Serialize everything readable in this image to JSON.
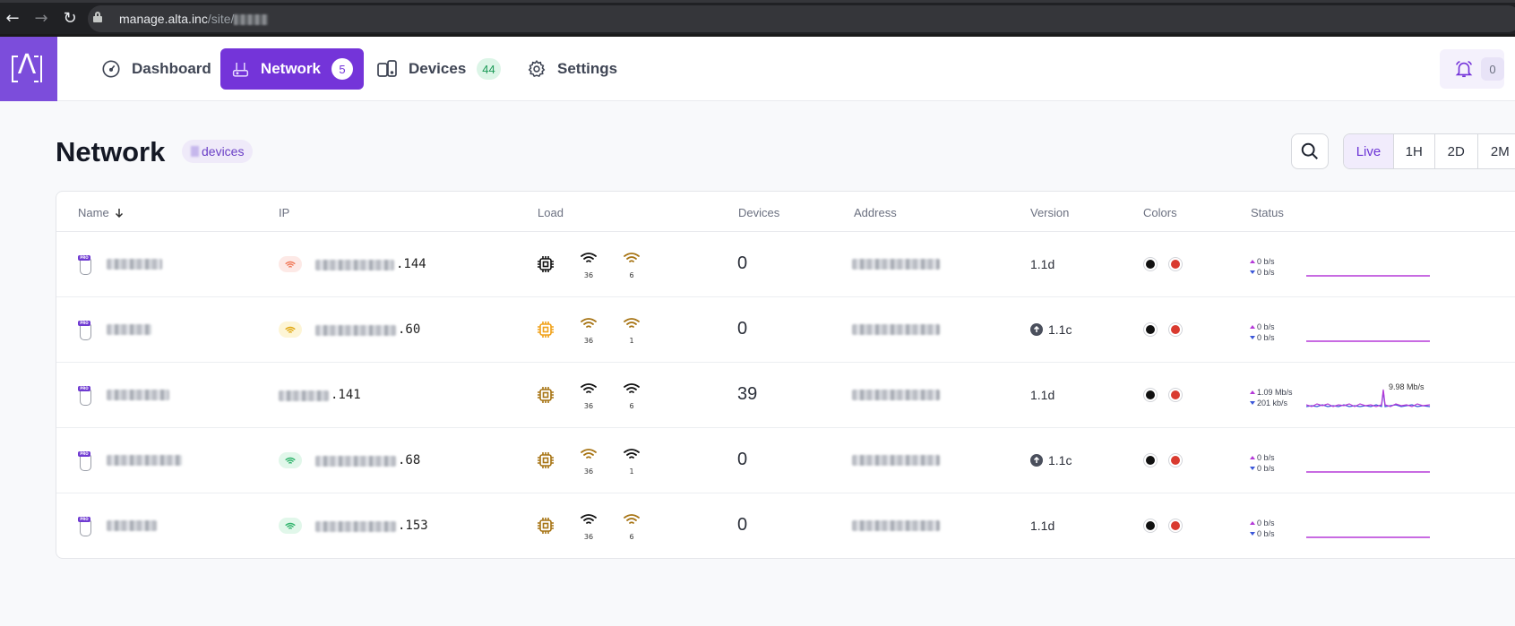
{
  "browser": {
    "url_domain": "manage.alta.inc",
    "url_path": "/site/"
  },
  "nav": {
    "tabs": [
      {
        "label": "Dashboard",
        "icon": "gauge-icon"
      },
      {
        "label": "Network",
        "icon": "router-icon",
        "badge": "5",
        "active": true
      },
      {
        "label": "Devices",
        "icon": "devices-icon",
        "badge": "44"
      },
      {
        "label": "Settings",
        "icon": "gear-icon"
      }
    ],
    "notifications_count": "0"
  },
  "page": {
    "title": "Network",
    "chip_label": "devices"
  },
  "time_ranges": [
    "Live",
    "1H",
    "2D",
    "2M"
  ],
  "table": {
    "headers": {
      "name": "Name",
      "ip": "IP",
      "load": "Load",
      "devices": "Devices",
      "address": "Address",
      "version": "Version",
      "colors": "Colors",
      "status": "Status"
    },
    "rows": [
      {
        "ip_suffix": ".144",
        "wifi_pill_color": "#fde9e6",
        "wifi_icon_color": "#f07a5a",
        "cpu_color": "#111111",
        "wifi1": "36",
        "wifi1_color": "#111111",
        "wifi2": "6",
        "wifi2_color": "#a77414",
        "devices": "0",
        "version": "1.1d",
        "update_available": false,
        "status_up": "0 b/s",
        "status_down": "0 b/s",
        "peak": ""
      },
      {
        "ip_suffix": ".60",
        "wifi_pill_color": "#fdf5d6",
        "wifi_icon_color": "#e0a710",
        "cpu_color": "#f0a21a",
        "wifi1": "36",
        "wifi1_color": "#a77414",
        "wifi2": "1",
        "wifi2_color": "#a77414",
        "devices": "0",
        "version": "1.1c",
        "update_available": true,
        "status_up": "0 b/s",
        "status_down": "0 b/s",
        "peak": ""
      },
      {
        "ip_suffix": ".141",
        "wifi_pill_color": "",
        "wifi_icon_color": "",
        "cpu_color": "#a77414",
        "wifi1": "36",
        "wifi1_color": "#111111",
        "wifi2": "6",
        "wifi2_color": "#111111",
        "devices": "39",
        "version": "1.1d",
        "update_available": false,
        "status_up": "1.09 Mb/s",
        "status_down": "201 kb/s",
        "peak": "9.98 Mb/s"
      },
      {
        "ip_suffix": ".68",
        "wifi_pill_color": "#e1f7ea",
        "wifi_icon_color": "#2fb36b",
        "cpu_color": "#a77414",
        "wifi1": "36",
        "wifi1_color": "#a77414",
        "wifi2": "1",
        "wifi2_color": "#111111",
        "devices": "0",
        "version": "1.1c",
        "update_available": true,
        "status_up": "0 b/s",
        "status_down": "0 b/s",
        "peak": ""
      },
      {
        "ip_suffix": ".153",
        "wifi_pill_color": "#e1f7ea",
        "wifi_icon_color": "#2fb36b",
        "cpu_color": "#a77414",
        "wifi1": "36",
        "wifi1_color": "#111111",
        "wifi2": "6",
        "wifi2_color": "#a77414",
        "devices": "0",
        "version": "1.1d",
        "update_available": false,
        "status_up": "0 b/s",
        "status_down": "0 b/s",
        "peak": ""
      }
    ]
  },
  "colors": {
    "accent": "#7434d9",
    "dot_black": "#111111",
    "dot_red": "#d93a2f",
    "spark_flat": "#b53ad8",
    "spark_up": "#b53ad8",
    "spark_down": "#3b57d9"
  }
}
